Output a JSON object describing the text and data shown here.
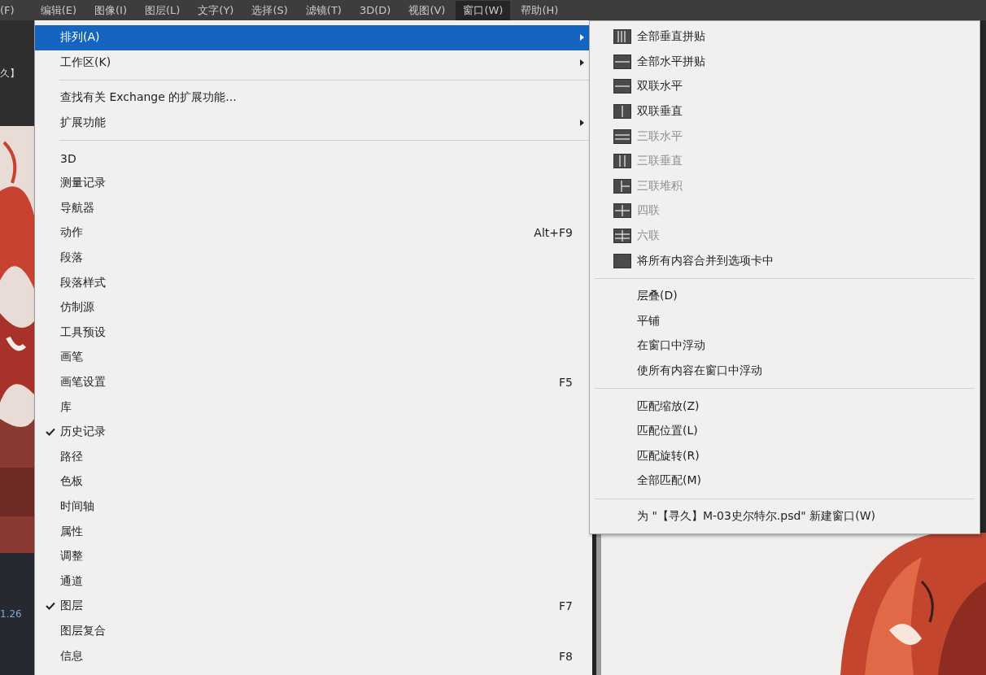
{
  "menubar": [
    {
      "label": "(F)",
      "selected": false
    },
    {
      "label": "编辑(E)",
      "selected": false
    },
    {
      "label": "图像(I)",
      "selected": false
    },
    {
      "label": "图层(L)",
      "selected": false
    },
    {
      "label": "文字(Y)",
      "selected": false
    },
    {
      "label": "选择(S)",
      "selected": false
    },
    {
      "label": "滤镜(T)",
      "selected": false
    },
    {
      "label": "3D(D)",
      "selected": false
    },
    {
      "label": "视图(V)",
      "selected": false
    },
    {
      "label": "窗口(W)",
      "selected": true
    },
    {
      "label": "帮助(H)",
      "selected": false
    }
  ],
  "workspace": {
    "tab_fragment": "久】",
    "zoom_fragment": "1.26"
  },
  "window_menu": {
    "sections": [
      [
        {
          "label": "排列(A)",
          "kind": "submenu",
          "selected": true,
          "checked": false
        },
        {
          "label": "工作区(K)",
          "kind": "submenu",
          "selected": false,
          "checked": false
        }
      ],
      [
        {
          "label": "查找有关 Exchange 的扩展功能...",
          "kind": "item",
          "selected": false,
          "checked": false
        },
        {
          "label": "扩展功能",
          "kind": "submenu",
          "selected": false,
          "checked": false
        }
      ],
      [
        {
          "label": "3D",
          "kind": "item",
          "selected": false,
          "checked": false
        },
        {
          "label": "测量记录",
          "kind": "item",
          "selected": false,
          "checked": false
        },
        {
          "label": "导航器",
          "kind": "item",
          "selected": false,
          "checked": false
        },
        {
          "label": "动作",
          "kind": "item",
          "selected": false,
          "checked": false,
          "shortcut": "Alt+F9"
        },
        {
          "label": "段落",
          "kind": "item",
          "selected": false,
          "checked": false
        },
        {
          "label": "段落样式",
          "kind": "item",
          "selected": false,
          "checked": false
        },
        {
          "label": "仿制源",
          "kind": "item",
          "selected": false,
          "checked": false
        },
        {
          "label": "工具预设",
          "kind": "item",
          "selected": false,
          "checked": false
        },
        {
          "label": "画笔",
          "kind": "item",
          "selected": false,
          "checked": false
        },
        {
          "label": "画笔设置",
          "kind": "item",
          "selected": false,
          "checked": false,
          "shortcut": "F5"
        },
        {
          "label": "库",
          "kind": "item",
          "selected": false,
          "checked": false
        },
        {
          "label": "历史记录",
          "kind": "item",
          "selected": false,
          "checked": true
        },
        {
          "label": "路径",
          "kind": "item",
          "selected": false,
          "checked": false
        },
        {
          "label": "色板",
          "kind": "item",
          "selected": false,
          "checked": false
        },
        {
          "label": "时间轴",
          "kind": "item",
          "selected": false,
          "checked": false
        },
        {
          "label": "属性",
          "kind": "item",
          "selected": false,
          "checked": false
        },
        {
          "label": "调整",
          "kind": "item",
          "selected": false,
          "checked": false
        },
        {
          "label": "通道",
          "kind": "item",
          "selected": false,
          "checked": false
        },
        {
          "label": "图层",
          "kind": "item",
          "selected": false,
          "checked": true,
          "shortcut": "F7"
        },
        {
          "label": "图层复合",
          "kind": "item",
          "selected": false,
          "checked": false
        },
        {
          "label": "信息",
          "kind": "item",
          "selected": false,
          "checked": false,
          "shortcut": "F8"
        }
      ]
    ]
  },
  "arrange_submenu": {
    "sections": [
      [
        {
          "label": "全部垂直拼贴",
          "kind": "tile",
          "disabled": false
        },
        {
          "label": "全部水平拼贴",
          "kind": "tile",
          "disabled": false
        },
        {
          "label": "双联水平",
          "kind": "tile",
          "disabled": false
        },
        {
          "label": "双联垂直",
          "kind": "tile",
          "disabled": false
        },
        {
          "label": "三联水平",
          "kind": "tile",
          "disabled": true
        },
        {
          "label": "三联垂直",
          "kind": "tile",
          "disabled": true
        },
        {
          "label": "三联堆积",
          "kind": "tile",
          "disabled": true
        },
        {
          "label": "四联",
          "kind": "tile",
          "disabled": true
        },
        {
          "label": "六联",
          "kind": "tile",
          "disabled": true
        },
        {
          "label": "将所有内容合并到选项卡中",
          "kind": "tile",
          "disabled": false
        }
      ],
      [
        {
          "label": "层叠(D)",
          "kind": "plain",
          "disabled": false
        },
        {
          "label": "平铺",
          "kind": "plain",
          "disabled": false
        },
        {
          "label": "在窗口中浮动",
          "kind": "plain",
          "disabled": false
        },
        {
          "label": "使所有内容在窗口中浮动",
          "kind": "plain",
          "disabled": false
        }
      ],
      [
        {
          "label": "匹配缩放(Z)",
          "kind": "plain",
          "disabled": false
        },
        {
          "label": "匹配位置(L)",
          "kind": "plain",
          "disabled": false
        },
        {
          "label": "匹配旋转(R)",
          "kind": "plain",
          "disabled": false
        },
        {
          "label": "全部匹配(M)",
          "kind": "plain",
          "disabled": false
        }
      ],
      [
        {
          "label": "为 \"【寻久】M-03史尔特尔.psd\" 新建窗口(W)",
          "kind": "plain",
          "disabled": false
        }
      ]
    ]
  }
}
